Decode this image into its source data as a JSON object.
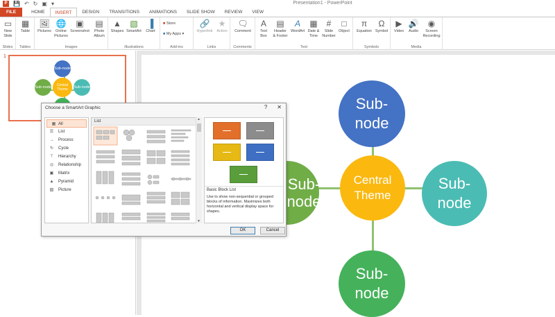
{
  "app": {
    "title": "Presentation1 - PowerPoint"
  },
  "quick_access": {
    "items": [
      "save-icon",
      "undo-icon",
      "redo-icon",
      "present-icon"
    ]
  },
  "tabs": [
    "FILE",
    "HOME",
    "INSERT",
    "DESIGN",
    "TRANSITIONS",
    "ANIMATIONS",
    "SLIDE SHOW",
    "REVIEW",
    "VIEW"
  ],
  "active_tab": "INSERT",
  "ribbon": {
    "groups": [
      {
        "label": "Slides",
        "commands": [
          "New\nSlide"
        ]
      },
      {
        "label": "Tables",
        "commands": [
          "Table"
        ]
      },
      {
        "label": "Images",
        "commands": [
          "Pictures",
          "Online\nPictures",
          "Screenshot",
          "Photo\nAlbum"
        ]
      },
      {
        "label": "Illustrations",
        "commands": [
          "Shapes",
          "SmartArt",
          "Chart"
        ]
      },
      {
        "label": "Add-ins",
        "commands": [
          "Store",
          "My Apps"
        ]
      },
      {
        "label": "Links",
        "commands": [
          "Hyperlink",
          "Action"
        ]
      },
      {
        "label": "Comments",
        "commands": [
          "Comment"
        ]
      },
      {
        "label": "Text",
        "commands": [
          "Text\nBox",
          "Header\n& Footer",
          "WordArt",
          "Date &\nTime",
          "Slide\nNumber",
          "Object"
        ]
      },
      {
        "label": "Symbols",
        "commands": [
          "Equation",
          "Symbol"
        ]
      },
      {
        "label": "Media",
        "commands": [
          "Video",
          "Audio",
          "Screen\nRecording"
        ]
      }
    ]
  },
  "thumbnail": {
    "number": "1"
  },
  "slide": {
    "center": "Central Theme",
    "top": "Sub-node",
    "left": "Sub-node",
    "right": "Sub-node",
    "bottom": "Sub-node",
    "colors": {
      "center": "#fbb80f",
      "top": "#4472c4",
      "left": "#70ad47",
      "right": "#4bbcb3",
      "bottom": "#45b25b",
      "line": "#8fc16e"
    }
  },
  "dialog": {
    "title": "Choose a SmartArt Graphic",
    "help": "?",
    "close": "✕",
    "categories": [
      {
        "label": "All",
        "icon": "all-icon"
      },
      {
        "label": "List",
        "icon": "list-icon"
      },
      {
        "label": "Process",
        "icon": "process-icon"
      },
      {
        "label": "Cycle",
        "icon": "cycle-icon"
      },
      {
        "label": "Hierarchy",
        "icon": "hierarchy-icon"
      },
      {
        "label": "Relationship",
        "icon": "relationship-icon"
      },
      {
        "label": "Matrix",
        "icon": "matrix-icon"
      },
      {
        "label": "Pyramid",
        "icon": "pyramid-icon"
      },
      {
        "label": "Picture",
        "icon": "picture-icon"
      }
    ],
    "selected_category": "All",
    "gallery_header": "List",
    "preview_name": "Basic Block List",
    "preview_description": "Use to show non-sequential or grouped blocks of information. Maximizes both horizontal and vertical display space for shapes.",
    "preview_colors": [
      "#e26f2a",
      "#8c8c8c",
      "#e6b914",
      "#3e6fc2",
      "#5a9e3c"
    ],
    "ok": "OK",
    "cancel": "Cancel"
  }
}
